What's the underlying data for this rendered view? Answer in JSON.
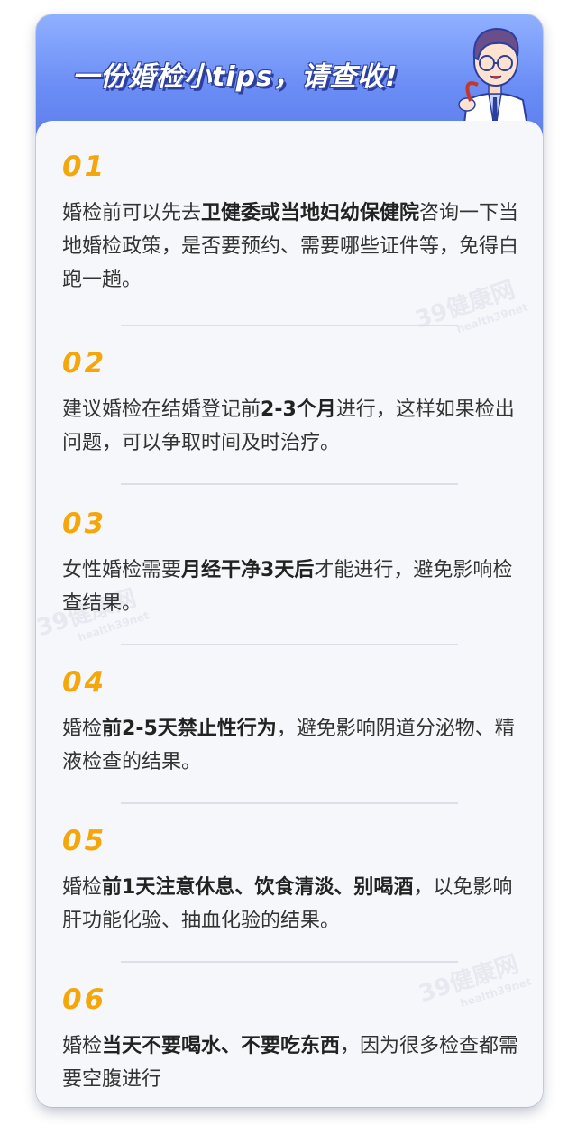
{
  "header": {
    "title": "一份婚检小tips，请查收!"
  },
  "watermark": {
    "brand": "39健康网",
    "domain": "health39net"
  },
  "tips": [
    {
      "num": "01",
      "parts": [
        {
          "t": "婚检前可以先去",
          "b": false
        },
        {
          "t": "卫健委或当地妇幼保健院",
          "b": true
        },
        {
          "t": "咨询一下当地婚检政策，是否要预约、需要哪些证件等，免得白跑一趟。",
          "b": false
        }
      ]
    },
    {
      "num": "02",
      "parts": [
        {
          "t": "建议婚检在结婚登记前",
          "b": false
        },
        {
          "t": "2-3个月",
          "b": true
        },
        {
          "t": "进行，这样如果检出问题，可以争取时间及时治疗。",
          "b": false
        }
      ]
    },
    {
      "num": "03",
      "parts": [
        {
          "t": "女性婚检需要",
          "b": false
        },
        {
          "t": "月经干净3天后",
          "b": true
        },
        {
          "t": "才能进行，避免影响检查结果。",
          "b": false
        }
      ]
    },
    {
      "num": "04",
      "parts": [
        {
          "t": "婚检",
          "b": false
        },
        {
          "t": "前2-5天禁止性行为",
          "b": true
        },
        {
          "t": "，避免影响阴道分泌物、精液检查的结果。",
          "b": false
        }
      ]
    },
    {
      "num": "05",
      "parts": [
        {
          "t": "婚检",
          "b": false
        },
        {
          "t": "前1天注意休息、饮食清淡、别喝酒",
          "b": true
        },
        {
          "t": "，以免影响肝功能化验、抽血化验的结果。",
          "b": false
        }
      ]
    },
    {
      "num": "06",
      "parts": [
        {
          "t": "婚检",
          "b": false
        },
        {
          "t": "当天不要喝水、不要吃东西",
          "b": true
        },
        {
          "t": "，因为很多检查都需要空腹进行",
          "b": false
        }
      ]
    }
  ]
}
